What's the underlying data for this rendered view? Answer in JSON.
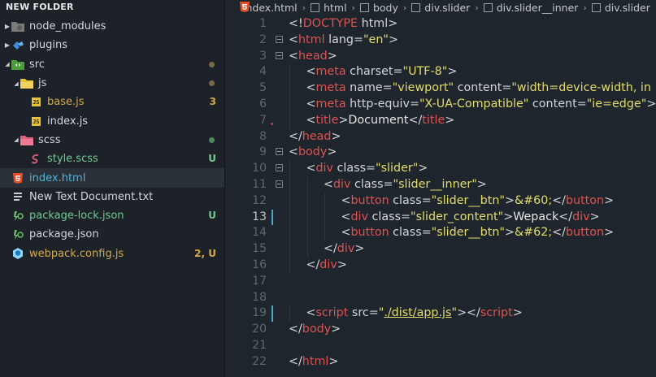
{
  "sidebar": {
    "header": "NEW FOLDER",
    "items": [
      {
        "label": "node_modules",
        "kind": "folder",
        "expanded": false,
        "depth": 0,
        "icon": "folder-icon",
        "color": "#7a7a7a"
      },
      {
        "label": "plugins",
        "kind": "folder",
        "expanded": false,
        "depth": 0,
        "icon": "plugins-folder-icon",
        "color": "#3b8ee0"
      },
      {
        "label": "src",
        "kind": "folder",
        "expanded": true,
        "depth": 0,
        "icon": "src-folder-icon",
        "color": "#7ac95a",
        "status": "dot"
      },
      {
        "label": "js",
        "kind": "folder",
        "expanded": true,
        "depth": 1,
        "icon": "js-folder-icon",
        "color": "#e8c33a",
        "status": "dot"
      },
      {
        "label": "base.js",
        "kind": "file",
        "depth": 2,
        "icon": "js-file-icon",
        "status": "3"
      },
      {
        "label": "index.js",
        "kind": "file",
        "depth": 2,
        "icon": "js-file-icon"
      },
      {
        "label": "scss",
        "kind": "folder",
        "expanded": true,
        "depth": 1,
        "icon": "scss-folder-icon",
        "color": "#e0607e",
        "status": "dot"
      },
      {
        "label": "style.scss",
        "kind": "file",
        "depth": 2,
        "icon": "scss-file-icon",
        "status": "U"
      },
      {
        "label": "index.html",
        "kind": "file",
        "depth": 0,
        "icon": "html-file-icon",
        "selected": true
      },
      {
        "label": "New Text Document.txt",
        "kind": "file",
        "depth": 0,
        "icon": "text-file-icon"
      },
      {
        "label": "package-lock.json",
        "kind": "file",
        "depth": 0,
        "icon": "npm-json-icon",
        "status": "U"
      },
      {
        "label": "package.json",
        "kind": "file",
        "depth": 0,
        "icon": "npm-json-icon"
      },
      {
        "label": "webpack.config.js",
        "kind": "file",
        "depth": 0,
        "icon": "webpack-icon",
        "status": "2, U"
      }
    ]
  },
  "breadcrumb": [
    "index.html",
    "html",
    "body",
    "div.slider",
    "div.slider__inner",
    "div.slider"
  ],
  "editor": {
    "active_line": 13,
    "lines": [
      {
        "n": "1",
        "tokens": [
          [
            "t-punc",
            "<!"
          ],
          [
            "t-tag",
            "DOCTYPE"
          ],
          [
            "t-punc",
            " html>"
          ]
        ]
      },
      {
        "n": "2",
        "fold": true,
        "tokens": [
          [
            "t-punc",
            "<"
          ],
          [
            "t-tag",
            "html"
          ],
          [
            "t-attr",
            " lang"
          ],
          [
            "t-punc",
            "="
          ],
          [
            "t-str",
            "\"en\""
          ],
          [
            "t-punc",
            ">"
          ]
        ]
      },
      {
        "n": "3",
        "fold": true,
        "tokens": [
          [
            "t-punc",
            "<"
          ],
          [
            "t-tag",
            "head"
          ],
          [
            "t-punc",
            ">"
          ]
        ]
      },
      {
        "n": "4",
        "indent": 1,
        "tokens": [
          [
            "t-punc",
            "<"
          ],
          [
            "t-tag",
            "meta"
          ],
          [
            "t-attr",
            " charset"
          ],
          [
            "t-punc",
            "="
          ],
          [
            "t-str",
            "\"UTF-8\""
          ],
          [
            "t-punc",
            ">"
          ]
        ]
      },
      {
        "n": "5",
        "indent": 1,
        "tokens": [
          [
            "t-punc",
            "<"
          ],
          [
            "t-tag",
            "meta"
          ],
          [
            "t-attr",
            " name"
          ],
          [
            "t-punc",
            "="
          ],
          [
            "t-str",
            "\"viewport\""
          ],
          [
            "t-attr",
            " content"
          ],
          [
            "t-punc",
            "="
          ],
          [
            "t-str",
            "\"width=device-width, in"
          ]
        ]
      },
      {
        "n": "6",
        "indent": 1,
        "tokens": [
          [
            "t-punc",
            "<"
          ],
          [
            "t-tag",
            "meta"
          ],
          [
            "t-attr",
            " http-equiv"
          ],
          [
            "t-punc",
            "="
          ],
          [
            "t-str",
            "\"X-UA-Compatible\""
          ],
          [
            "t-attr",
            " content"
          ],
          [
            "t-punc",
            "="
          ],
          [
            "t-str",
            "\"ie=edge\""
          ],
          [
            "t-punc",
            ">"
          ]
        ]
      },
      {
        "n": "7",
        "indent": 1,
        "tokens": [
          [
            "t-punc",
            "<"
          ],
          [
            "t-tag",
            "title"
          ],
          [
            "t-punc",
            ">"
          ],
          [
            "t-txt",
            "Document"
          ],
          [
            "t-punc",
            "</"
          ],
          [
            "t-tag",
            "title"
          ],
          [
            "t-punc",
            ">"
          ]
        ]
      },
      {
        "n": "8",
        "tokens": [
          [
            "t-punc",
            "</"
          ],
          [
            "t-tag",
            "head"
          ],
          [
            "t-punc",
            ">"
          ]
        ]
      },
      {
        "n": "9",
        "fold": true,
        "tokens": [
          [
            "t-punc",
            "<"
          ],
          [
            "t-tag",
            "body"
          ],
          [
            "t-punc",
            ">"
          ]
        ]
      },
      {
        "n": "10",
        "fold": true,
        "indent": 1,
        "tokens": [
          [
            "t-punc",
            "<"
          ],
          [
            "t-tag",
            "div"
          ],
          [
            "t-attr",
            " class"
          ],
          [
            "t-punc",
            "="
          ],
          [
            "t-str",
            "\"slider\""
          ],
          [
            "t-punc",
            ">"
          ]
        ]
      },
      {
        "n": "11",
        "fold": true,
        "indent": 2,
        "tokens": [
          [
            "t-punc",
            "<"
          ],
          [
            "t-tag",
            "div"
          ],
          [
            "t-attr",
            " class"
          ],
          [
            "t-punc",
            "="
          ],
          [
            "t-str",
            "\"slider__inner\""
          ],
          [
            "t-punc",
            ">"
          ]
        ]
      },
      {
        "n": "12",
        "indent": 3,
        "tokens": [
          [
            "t-punc",
            "<"
          ],
          [
            "t-tag",
            "button"
          ],
          [
            "t-attr",
            " class"
          ],
          [
            "t-punc",
            "="
          ],
          [
            "t-str",
            "\"slider__btn\""
          ],
          [
            "t-punc",
            ">"
          ],
          [
            "t-ent",
            "&#60;"
          ],
          [
            "t-punc",
            "</"
          ],
          [
            "t-tag",
            "button"
          ],
          [
            "t-punc",
            ">"
          ]
        ]
      },
      {
        "n": "13",
        "indent": 3,
        "mod": true,
        "tokens": [
          [
            "t-punc",
            "<"
          ],
          [
            "t-tag",
            "div"
          ],
          [
            "t-attr",
            " class"
          ],
          [
            "t-punc",
            "="
          ],
          [
            "t-str",
            "\"slider_content\""
          ],
          [
            "t-punc",
            ">"
          ],
          [
            "t-txt",
            "Wepack"
          ],
          [
            "t-punc",
            "</"
          ],
          [
            "t-tag",
            "div"
          ],
          [
            "t-punc",
            ">"
          ]
        ]
      },
      {
        "n": "14",
        "indent": 3,
        "tokens": [
          [
            "t-punc",
            "<"
          ],
          [
            "t-tag",
            "button"
          ],
          [
            "t-attr",
            " class"
          ],
          [
            "t-punc",
            "="
          ],
          [
            "t-str",
            "\"slider__btn\""
          ],
          [
            "t-punc",
            ">"
          ],
          [
            "t-ent",
            "&#62;"
          ],
          [
            "t-punc",
            "</"
          ],
          [
            "t-tag",
            "button"
          ],
          [
            "t-punc",
            ">"
          ]
        ]
      },
      {
        "n": "15",
        "indent": 2,
        "tokens": [
          [
            "t-punc",
            "</"
          ],
          [
            "t-tag",
            "div"
          ],
          [
            "t-punc",
            ">"
          ]
        ]
      },
      {
        "n": "16",
        "indent": 1,
        "tokens": [
          [
            "t-punc",
            "</"
          ],
          [
            "t-tag",
            "div"
          ],
          [
            "t-punc",
            ">"
          ]
        ]
      },
      {
        "n": "17",
        "tokens": []
      },
      {
        "n": "18",
        "tokens": []
      },
      {
        "n": "19",
        "indent": 1,
        "mod": true,
        "tokens": [
          [
            "t-punc",
            "<"
          ],
          [
            "t-tag",
            "script"
          ],
          [
            "t-attr",
            " src"
          ],
          [
            "t-punc",
            "="
          ],
          [
            "t-str",
            "\""
          ],
          [
            "t-str underline-str",
            "./dist/app.js"
          ],
          [
            "t-str",
            "\""
          ],
          [
            "t-punc",
            "></"
          ],
          [
            "t-tag",
            "script"
          ],
          [
            "t-punc",
            ">"
          ]
        ]
      },
      {
        "n": "20",
        "tokens": [
          [
            "t-punc",
            "</"
          ],
          [
            "t-tag",
            "body"
          ],
          [
            "t-punc",
            ">"
          ]
        ]
      },
      {
        "n": "21",
        "tokens": []
      },
      {
        "n": "22",
        "tokens": [
          [
            "t-punc",
            "</"
          ],
          [
            "t-tag",
            "html"
          ],
          [
            "t-punc",
            ">"
          ]
        ]
      }
    ]
  }
}
